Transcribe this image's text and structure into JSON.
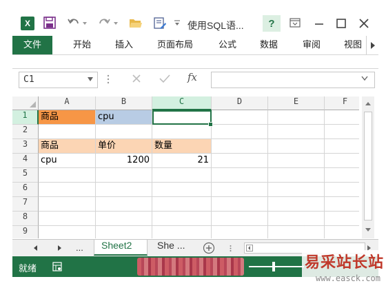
{
  "titlebar": {
    "logo_text": "X",
    "doc_title": "使用SQL语...",
    "help_label": "?"
  },
  "ribbon": {
    "tabs": [
      "文件",
      "开始",
      "插入",
      "页面布局",
      "公式",
      "数据",
      "审阅",
      "视图"
    ]
  },
  "formula_bar": {
    "name_box": "C1",
    "fx_label": "fx",
    "formula": ""
  },
  "sheet": {
    "columns": [
      "A",
      "B",
      "C",
      "D",
      "E",
      "F"
    ],
    "rows": [
      "1",
      "2",
      "3",
      "4",
      "5",
      "6",
      "7",
      "8",
      "9"
    ],
    "selected_cell": "C1",
    "cells": {
      "A1": "商品",
      "B1": "cpu",
      "A3": "商品",
      "B3": "单价",
      "C3": "数量",
      "A4": "cpu",
      "B4": "1200",
      "C4": "21"
    },
    "fill_colors": {
      "A1": "#f79646",
      "B1": "#b8cce4",
      "A3": "#fcd5b4",
      "B3": "#fcd5b4",
      "C3": "#fcd5b4"
    }
  },
  "sheet_tabs": {
    "nav_more": "...",
    "active": "Sheet2",
    "other": "She ...",
    "more": "..."
  },
  "statusbar": {
    "ready": "就绪"
  },
  "watermark": {
    "cn": "易采站长站",
    "url": "www.easck.com"
  },
  "colors": {
    "accent": "#217346",
    "grid_line": "#d4d4d4",
    "header_bg": "#f3f3f3"
  }
}
